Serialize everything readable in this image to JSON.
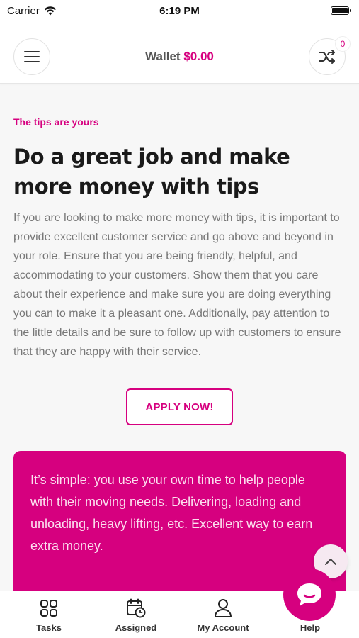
{
  "status_bar": {
    "carrier": "Carrier",
    "time": "6:19 PM"
  },
  "header": {
    "wallet_label": "Wallet",
    "wallet_amount": "$0.00",
    "shuffle_badge_count": "0"
  },
  "content": {
    "eyebrow": "The tips are yours",
    "headline": "Do a great job and make more money with tips",
    "body": "If you are looking to make more money with tips, it is important to provide excellent customer service and go above and beyond in your role. Ensure that you are being friendly, helpful, and accommodating to your customers. Show them that you care about their experience and make sure you are doing everything you can to make it a pleasant one. Additionally, pay attention to the little details and be sure to follow up with customers to ensure that they are happy with their service.",
    "apply_button": "APPLY NOW!",
    "promo_text": "It’s simple: you use your own time to help people with their moving needs. Delivering, loading and unloading, heavy lifting, etc. Excellent way to earn extra money."
  },
  "tabbar": {
    "tabs": [
      {
        "label": "Tasks",
        "icon": "grid-icon"
      },
      {
        "label": "Assigned",
        "icon": "calendar-clock-icon"
      },
      {
        "label": "My Account",
        "icon": "person-icon"
      },
      {
        "label": "Help",
        "icon": "chat-icon"
      }
    ]
  },
  "colors": {
    "accent": "#d6007f",
    "background": "#f7f7f7",
    "text": "#1a1a1a",
    "muted": "#777777"
  }
}
